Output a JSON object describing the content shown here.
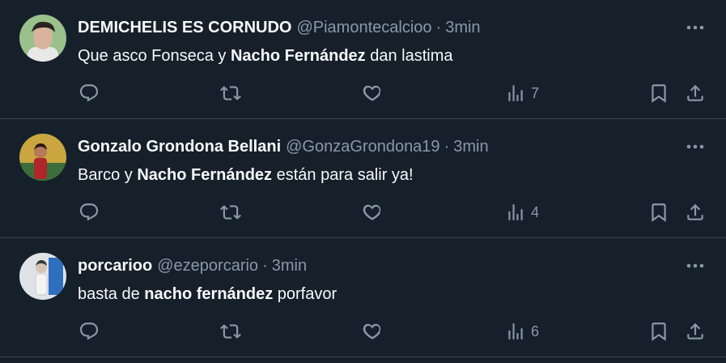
{
  "tweets": [
    {
      "name": "DEMICHELIS ES CORNUDO",
      "handle": "@Piamontecalcioo",
      "separator": "·",
      "time": "3min",
      "text_parts": [
        "Que asco Fonseca y ",
        "Nacho Fernández",
        " dan lastima"
      ],
      "views": "7",
      "avatar": {
        "bg": "#9ac08c",
        "skin": "#d9b49c",
        "hair": "#2b2420",
        "shirt": "#e8e8e8"
      }
    },
    {
      "name": "Gonzalo Grondona Bellani",
      "handle": "@GonzaGrondona19",
      "separator": "·",
      "time": "3min",
      "text_parts": [
        "Barco y ",
        "Nacho Fernández",
        " están para salir ya!"
      ],
      "views": "4",
      "avatar": {
        "bg": "#c9a640",
        "skin": "#b57a5a",
        "hair": "#2a1a14",
        "shirt": "#b0262b"
      }
    },
    {
      "name": "porcarioo",
      "handle": "@ezeporcario",
      "separator": "·",
      "time": "3min",
      "text_parts": [
        "basta de ",
        "nacho fernández",
        " porfavor"
      ],
      "views": "6",
      "avatar": {
        "bg": "#dfe3e8",
        "skin": "#d8c4b4",
        "hair": "#3a3a3a",
        "shirt": "#f4f4f4"
      }
    }
  ],
  "colors": {
    "background": "#15202b",
    "divider": "#38444d",
    "secondary_text": "#8b98a5",
    "primary_text": "#f7f9f9"
  },
  "icons": [
    "more-icon",
    "reply-icon",
    "retweet-icon",
    "like-icon",
    "views-icon",
    "bookmark-icon",
    "share-icon"
  ]
}
